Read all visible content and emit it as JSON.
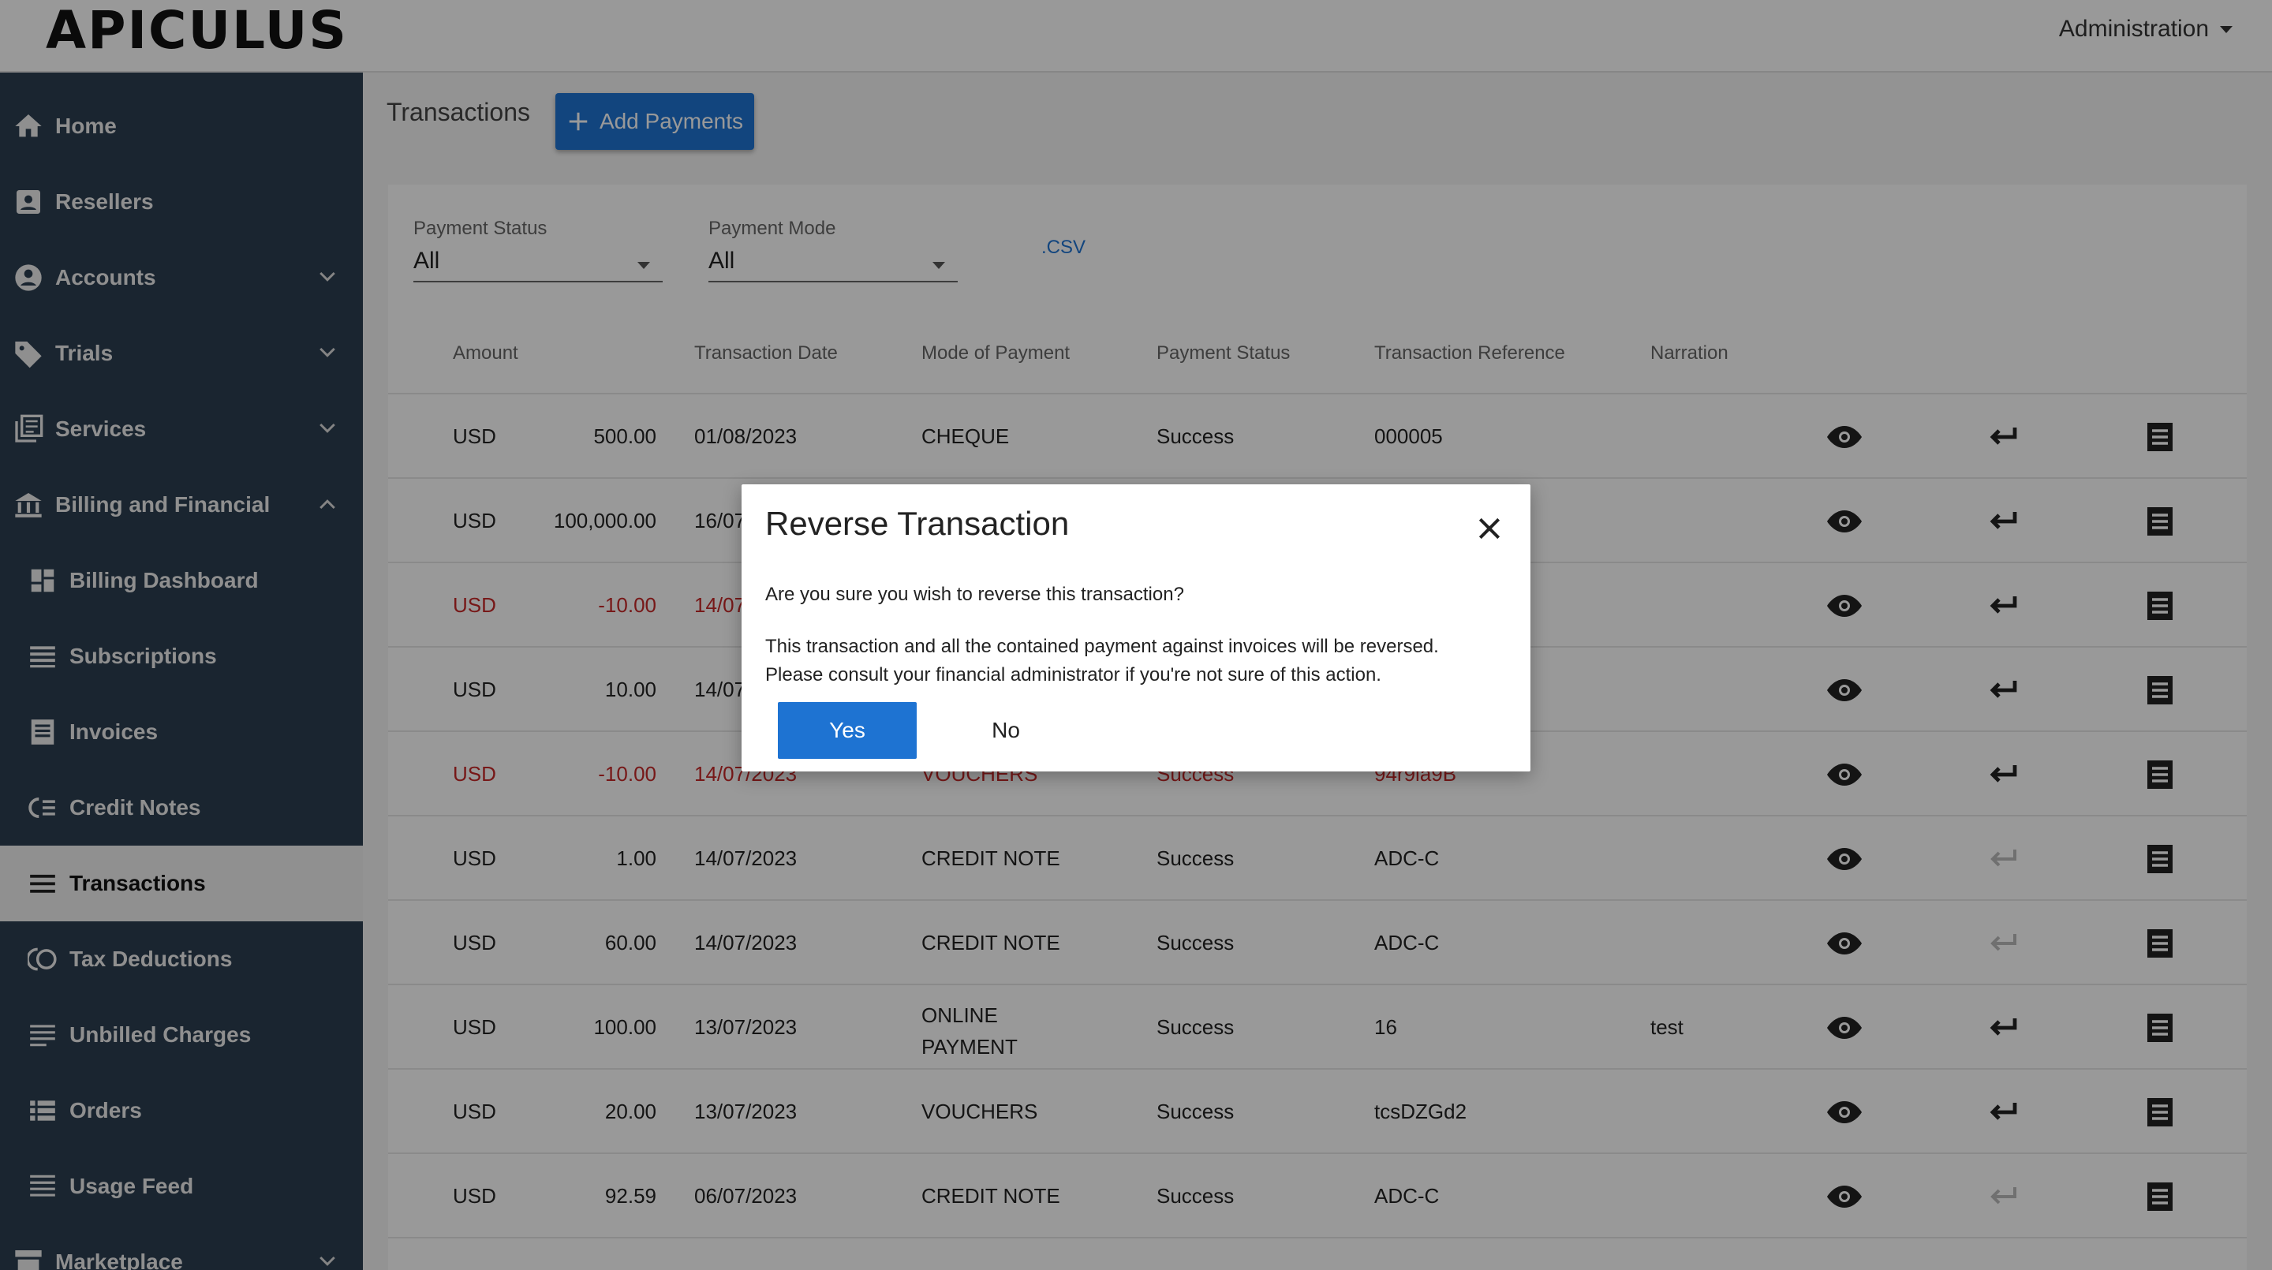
{
  "header": {
    "logo": "APICULUS",
    "admin_label": "Administration"
  },
  "sidebar": {
    "items": [
      {
        "label": "Home",
        "icon": "home-icon"
      },
      {
        "label": "Resellers",
        "icon": "person-badge-icon"
      },
      {
        "label": "Accounts",
        "icon": "account-circle-icon"
      },
      {
        "label": "Trials",
        "icon": "tag-icon"
      },
      {
        "label": "Services",
        "icon": "library-icon"
      },
      {
        "label": "Billing and Financial",
        "icon": "bank-icon"
      },
      {
        "label": "Billing Dashboard",
        "icon": "dashboard-icon"
      },
      {
        "label": "Subscriptions",
        "icon": "lines-icon"
      },
      {
        "label": "Invoices",
        "icon": "receipt-icon"
      },
      {
        "label": "Credit Notes",
        "icon": "credit-note-icon"
      },
      {
        "label": "Transactions",
        "icon": "menu-icon"
      },
      {
        "label": "Tax Deductions",
        "icon": "tax-icon"
      },
      {
        "label": "Unbilled Charges",
        "icon": "list-icon"
      },
      {
        "label": "Orders",
        "icon": "orders-icon"
      },
      {
        "label": "Usage Feed",
        "icon": "feed-icon"
      },
      {
        "label": "Marketplace",
        "icon": "store-icon"
      }
    ]
  },
  "main": {
    "title": "Transactions",
    "add_button": "Add Payments",
    "filters": {
      "status_label": "Payment Status",
      "status_value": "All",
      "mode_label": "Payment Mode",
      "mode_value": "All",
      "csv_label": ".CSV"
    },
    "columns": [
      "Amount",
      "Transaction Date",
      "Mode of Payment",
      "Payment Status",
      "Transaction Reference",
      "Narration"
    ],
    "rows": [
      {
        "currency": "USD",
        "amount": "500.00",
        "date": "01/08/2023",
        "mode": "CHEQUE",
        "status": "Success",
        "reference": "000005",
        "narration": ""
      },
      {
        "currency": "USD",
        "amount": "100,000.00",
        "date": "16/07",
        "mode": "",
        "status": "",
        "reference": "",
        "narration": ""
      },
      {
        "currency": "USD",
        "amount": "-10.00",
        "date": "14/07",
        "mode": "",
        "status": "",
        "reference": "",
        "narration": ""
      },
      {
        "currency": "USD",
        "amount": "10.00",
        "date": "14/07",
        "mode": "",
        "status": "",
        "reference": "",
        "narration": ""
      },
      {
        "currency": "USD",
        "amount": "-10.00",
        "date": "14/07/2023",
        "mode": "VOUCHERS",
        "status": "Success",
        "reference": "94r9la9B",
        "narration": ""
      },
      {
        "currency": "USD",
        "amount": "1.00",
        "date": "14/07/2023",
        "mode": "CREDIT NOTE",
        "status": "Success",
        "reference": "ADC-C",
        "narration": ""
      },
      {
        "currency": "USD",
        "amount": "60.00",
        "date": "14/07/2023",
        "mode": "CREDIT NOTE",
        "status": "Success",
        "reference": "ADC-C",
        "narration": ""
      },
      {
        "currency": "USD",
        "amount": "100.00",
        "date": "13/07/2023",
        "mode_line1": "ONLINE",
        "mode_line2": "PAYMENT",
        "status": "Success",
        "reference": "16",
        "narration": "test"
      },
      {
        "currency": "USD",
        "amount": "20.00",
        "date": "13/07/2023",
        "mode": "VOUCHERS",
        "status": "Success",
        "reference": "tcsDZGd2",
        "narration": ""
      },
      {
        "currency": "USD",
        "amount": "92.59",
        "date": "06/07/2023",
        "mode": "CREDIT NOTE",
        "status": "Success",
        "reference": "ADC-C",
        "narration": ""
      }
    ]
  },
  "modal": {
    "title": "Reverse Transaction",
    "question": "Are you sure you wish to reverse this transaction?",
    "message_line1": "This transaction and all the contained payment against invoices will be reversed.",
    "message_line2": "Please consult your financial administrator if you're not sure of this action.",
    "yes_label": "Yes",
    "no_label": "No"
  },
  "colors": {
    "sidebar_bg": "#2c3e50",
    "accent": "#1e73d2",
    "negative": "#c62828"
  }
}
